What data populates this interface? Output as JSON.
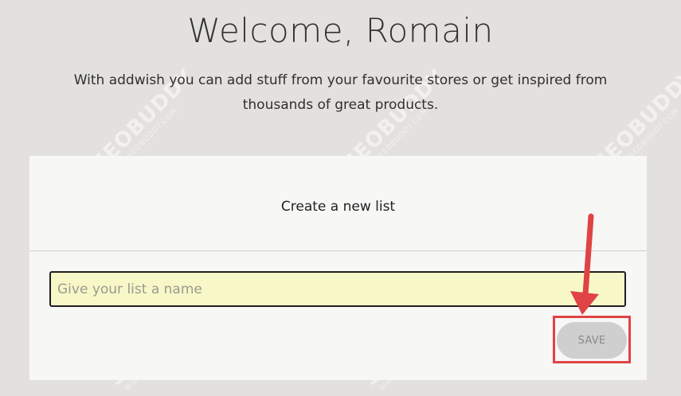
{
  "header": {
    "title": "Welcome, Romain",
    "subtitle_line1": "With addwish you can add stuff from your favourite stores or get inspired from",
    "subtitle_line2": "thousands of great products."
  },
  "card": {
    "title": "Create a new list",
    "input_placeholder": "Give your list a name",
    "save_label": "SAVE"
  },
  "watermark": {
    "brand": "SEOBUDDY",
    "url": "WWW.SEOBUDDY.COM"
  },
  "colors": {
    "background": "#e3e1dd",
    "card": "#f7f7f6",
    "input_fill": "#f8f7c8",
    "annotation": "#e04343",
    "button": "#cfcfcf"
  }
}
